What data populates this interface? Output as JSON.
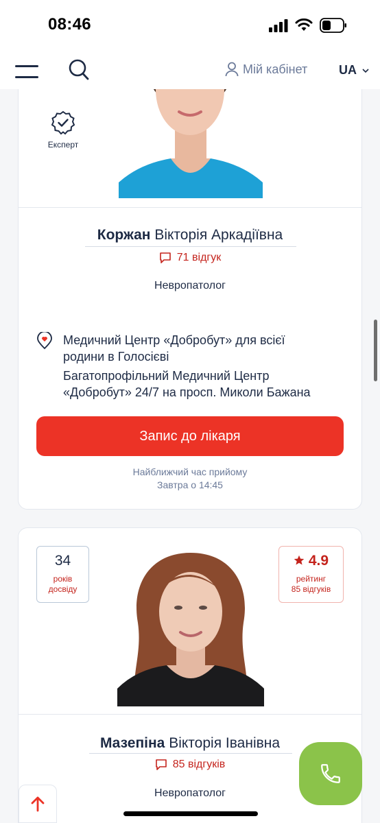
{
  "status_bar": {
    "time": "08:46"
  },
  "nav": {
    "cabinet_label": "Мій кабінет",
    "lang": "UA"
  },
  "doctors": [
    {
      "expert_label": "Експерт",
      "surname": "Коржан",
      "given_names": "Вікторія Аркадіївна",
      "reviews": "71 відгук",
      "specialty": "Невропатолог",
      "clinic_line1": "Медичний Центр «Добробут» для всієї",
      "clinic_line2": "родини в Голосієві",
      "clinic_line3": "Багатопрофільний Медичний Центр",
      "clinic_line4": "«Добробут» 24/7 на просп. Миколи Бажана",
      "book_label": "Запис до лікаря",
      "nearest_label": "Найближчий час прийому",
      "nearest_time": "Завтра о 14:45"
    },
    {
      "experience_years": "34",
      "experience_label_1": "років",
      "experience_label_2": "досвіду",
      "rating": "4.9",
      "rating_label": "рейтинг",
      "rating_reviews": "85 відгуків",
      "surname": "Мазепіна",
      "given_names": "Вікторія Іванівна",
      "reviews": "85 відгуків",
      "specialty": "Невропатолог"
    }
  ],
  "colors": {
    "accent_red": "#ec3326",
    "navy": "#1d2a44",
    "call_green": "#8bc34a"
  }
}
